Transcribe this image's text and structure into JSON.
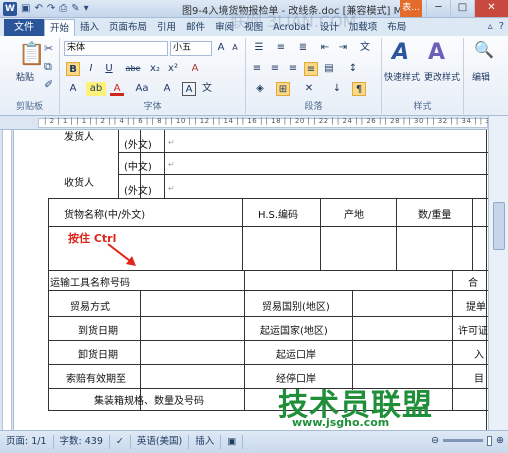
{
  "titlebar": {
    "app_icon": "W",
    "title": "图9-4入境货物报检单 - 改线条.doc [兼容模式] M...",
    "badge": "表...",
    "minimize": "─",
    "maximize": "□",
    "close": "✕"
  },
  "quick_access": [
    "save-icon",
    "undo-icon",
    "redo-icon",
    "print-icon",
    "format-painter-icon"
  ],
  "tabs": {
    "file": "文件",
    "items": [
      "开始",
      "插入",
      "页面布局",
      "引用",
      "邮件",
      "审阅",
      "视图",
      "Acrobat",
      "设计",
      "加载项",
      "布局"
    ],
    "active_index": 0
  },
  "watermark_top": "联网 3LIAN.COM",
  "ribbon": {
    "clipboard": {
      "label": "剪贴板",
      "paste": "粘贴"
    },
    "font": {
      "label": "字体",
      "font_name": "宋体",
      "font_size": "小五",
      "grow": "A",
      "shrink": "A",
      "bold": "B",
      "italic": "I",
      "underline": "U",
      "strike": "abe",
      "subscript": "x₂",
      "superscript": "x²",
      "clear": "A",
      "highlight": "ab",
      "color": "A",
      "case": "Aa",
      "phonetic": "文",
      "border": "A"
    },
    "paragraph": {
      "label": "段落"
    },
    "styles": {
      "label": "样式",
      "quick": "快速样式",
      "change": "更改样式"
    },
    "editing": {
      "label": "编辑"
    }
  },
  "ruler_ticks": "| 2 | 1 | | 1 | | 2 | | 4 | | 6 | | 8 | | 10 | | 12 | | 14 | | 16 | | 18 | | 20 | | 22 | | 24 | | 26 | | 28 | | 30 | | 32 | | 34 | | 36 |",
  "table": {
    "sender_label": "发货人",
    "foreign1": "(外文)",
    "consignee_label": "收货人",
    "chinese": "(中文)",
    "foreign2": "(外文)",
    "goods_name": "货物名称(中/外文)",
    "hs_code": "H.S.编码",
    "origin": "产地",
    "quantity": "数/重量",
    "transport": "运输工具名称号码",
    "trade_mode": "贸易方式",
    "trade_country": "贸易国别(地区)",
    "bill": "提单",
    "arrival_date": "到货日期",
    "ship_country": "起运国家(地区)",
    "permit": "许可证",
    "unload_date": "卸货日期",
    "ship_port": "起运口岸",
    "entry": "入",
    "claim_deadline": "索赔有效期至",
    "via_port": "经停口岸",
    "dest": "目",
    "container": "集装箱规格、数量及号码",
    "contract": "合",
    "para_mark": "↵"
  },
  "hint": "按住 Ctrl",
  "watermark_bottom": {
    "brand": "技术员联盟",
    "url": "www.jsgho.com"
  },
  "statusbar": {
    "page": "页面: 1/1",
    "words": "字数: 439",
    "language": "英语(美国)",
    "mode": "插入"
  }
}
